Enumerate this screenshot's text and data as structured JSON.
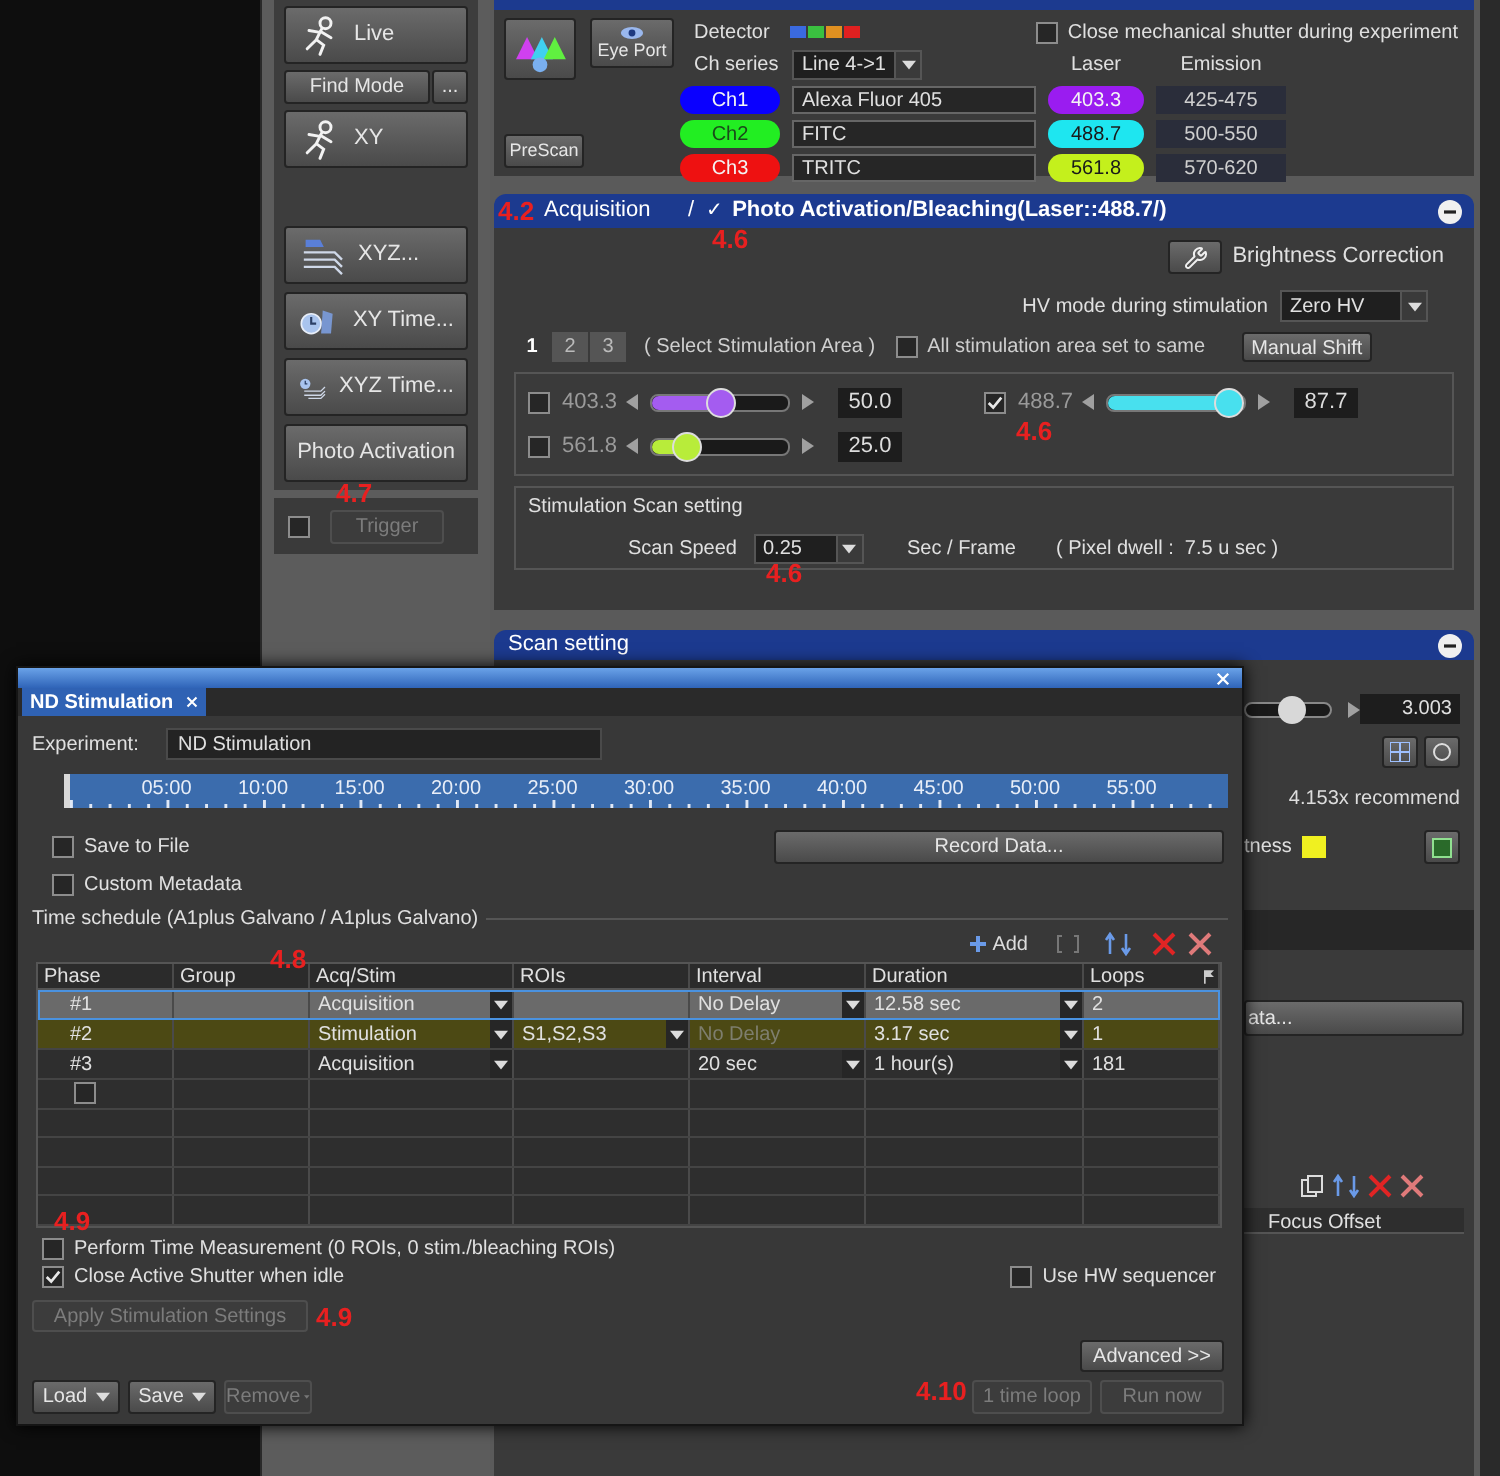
{
  "tool_groups": [
    [
      {
        "kind": "runner",
        "label": "Live"
      },
      {
        "kind": "split",
        "label": "Find Mode",
        "more": "..."
      },
      {
        "kind": "runner",
        "label": "XY"
      }
    ],
    [
      {
        "kind": "zstack",
        "label": "XYZ..."
      },
      {
        "kind": "timelapse",
        "label": "XY Time..."
      },
      {
        "kind": "zstack_time",
        "label": "XYZ Time..."
      },
      {
        "kind": "plain",
        "label": "Photo Activation"
      }
    ]
  ],
  "trigger": {
    "checked": false,
    "label": "Trigger",
    "disabled": true
  },
  "detector_panel": {
    "eye_port": "Eye Port",
    "prescan": "PreScan",
    "detector_label": "Detector",
    "ch_series_label": "Ch series",
    "ch_series": "Line 4->1",
    "shutter": {
      "label": "Close mechanical shutter during experiment",
      "checked": false
    },
    "laser_header": "Laser",
    "emission_header": "Emission",
    "channels": [
      {
        "name": "Ch1",
        "color": "#0a00ff",
        "dye": "Alexa Fluor 405",
        "laser": {
          "value": "403.3",
          "color": "#9a1cf0"
        },
        "emission": "425-475"
      },
      {
        "name": "Ch2",
        "color": "#22ee22",
        "dye": "FITC",
        "laser": {
          "value": "488.7",
          "color": "#1ee6f0"
        },
        "emission": "500-550"
      },
      {
        "name": "Ch3",
        "color": "#ee1111",
        "dye": "TRITC",
        "laser": {
          "value": "561.8",
          "color": "#c4f01c"
        },
        "emission": "570-620"
      }
    ]
  },
  "stimulation_panel": {
    "tab": "Acquisition",
    "separator": "/",
    "check": "✓",
    "title": "Photo Activation/Bleaching(Laser::488.7/)",
    "brightness": "Brightness Correction",
    "hv_label": "HV mode during stimulation",
    "hv_value": "Zero HV",
    "areas": [
      {
        "label": "1",
        "selected": true
      },
      {
        "label": "2",
        "selected": false
      },
      {
        "label": "3",
        "selected": false
      }
    ],
    "area_hint": "( Select Stimulation Area )",
    "same": {
      "label": "All stimulation area set to same",
      "checked": false
    },
    "manual_shift": "Manual Shift",
    "lasers": [
      {
        "wavelength": "403.3",
        "checked": false,
        "level": 0.5,
        "value": "50.0",
        "color": "#a45cf0"
      },
      {
        "wavelength": "488.7",
        "checked": true,
        "level": 0.877,
        "value": "87.7",
        "color": "#48e0ee"
      },
      {
        "wavelength": "561.8",
        "checked": false,
        "level": 0.25,
        "value": "25.0",
        "color": "#b8ec3a"
      }
    ],
    "scan_box": {
      "title": "Stimulation Scan setting",
      "speed_label": "Scan Speed",
      "speed": "0.25",
      "unit": "Sec / Frame",
      "dwell": "( Pixel dwell :  7.5 u sec )"
    }
  },
  "scan_setting": {
    "title": "Scan setting",
    "level": 0.55,
    "value": "3.003",
    "zoom_note": "4.153x recommend",
    "brightness_label": "tness"
  },
  "lower_panel": {
    "button": "ata...",
    "column": "Focus Offset"
  },
  "dialog": {
    "tab": "ND Stimulation",
    "experiment_label": "Experiment:",
    "experiment": "ND Stimulation",
    "timeline": [
      "05:00",
      "10:00",
      "15:00",
      "20:00",
      "25:00",
      "30:00",
      "35:00",
      "40:00",
      "45:00",
      "50:00",
      "55:00"
    ],
    "save_to_file": {
      "label": "Save to File",
      "checked": false
    },
    "record": "Record Data...",
    "custom_metadata": {
      "label": "Custom Metadata",
      "checked": false
    },
    "schedule_title": "Time schedule (A1plus Galvano / A1plus Galvano)",
    "add": "Add",
    "columns": [
      "Phase",
      "Group",
      "Acq/Stim",
      "ROIs",
      "Interval",
      "Duration",
      "Loops"
    ],
    "rows": [
      {
        "kind": "acquisition",
        "selected": true,
        "phase": "#1",
        "acq_stim": "Acquisition",
        "interval": "No Delay",
        "interval_disabled": false,
        "duration": "12.58 sec",
        "loops": "2"
      },
      {
        "kind": "stimulation",
        "selected": false,
        "phase": "#2",
        "acq_stim": "Stimulation",
        "rois": "S1,S2,S3",
        "interval": "No Delay",
        "interval_disabled": true,
        "duration": "3.17 sec",
        "loops": "1"
      },
      {
        "kind": "acquisition",
        "selected": false,
        "phase": "#3",
        "acq_stim": "Acquisition",
        "interval": "20 sec",
        "interval_disabled": false,
        "duration": "1 hour(s)",
        "loops": "181"
      },
      {
        "kind": "new",
        "selected": false,
        "checked": false
      }
    ],
    "perform": {
      "label": "Perform Time Measurement (0 ROIs, 0 stim./bleaching ROIs)",
      "checked": false
    },
    "close_shutter": {
      "label": "Close Active Shutter when idle",
      "checked": true
    },
    "hw_sequencer": {
      "label": "Use HW sequencer",
      "checked": false
    },
    "apply": {
      "label": "Apply Stimulation Settings",
      "disabled": true
    },
    "advanced": "Advanced >>",
    "load": "Load",
    "save": "Save",
    "remove": {
      "label": "Remove",
      "disabled": true
    },
    "loop": {
      "label": "1 time loop",
      "disabled": true
    },
    "run": {
      "label": "Run now",
      "disabled": true
    }
  },
  "annotations": [
    {
      "text": "4.2"
    },
    {
      "text": "4.6"
    },
    {
      "text": "4.6"
    },
    {
      "text": "4.6"
    },
    {
      "text": "4.7"
    },
    {
      "text": "4.8"
    },
    {
      "text": "4.9"
    },
    {
      "text": "4.9"
    },
    {
      "text": "4.10"
    }
  ]
}
